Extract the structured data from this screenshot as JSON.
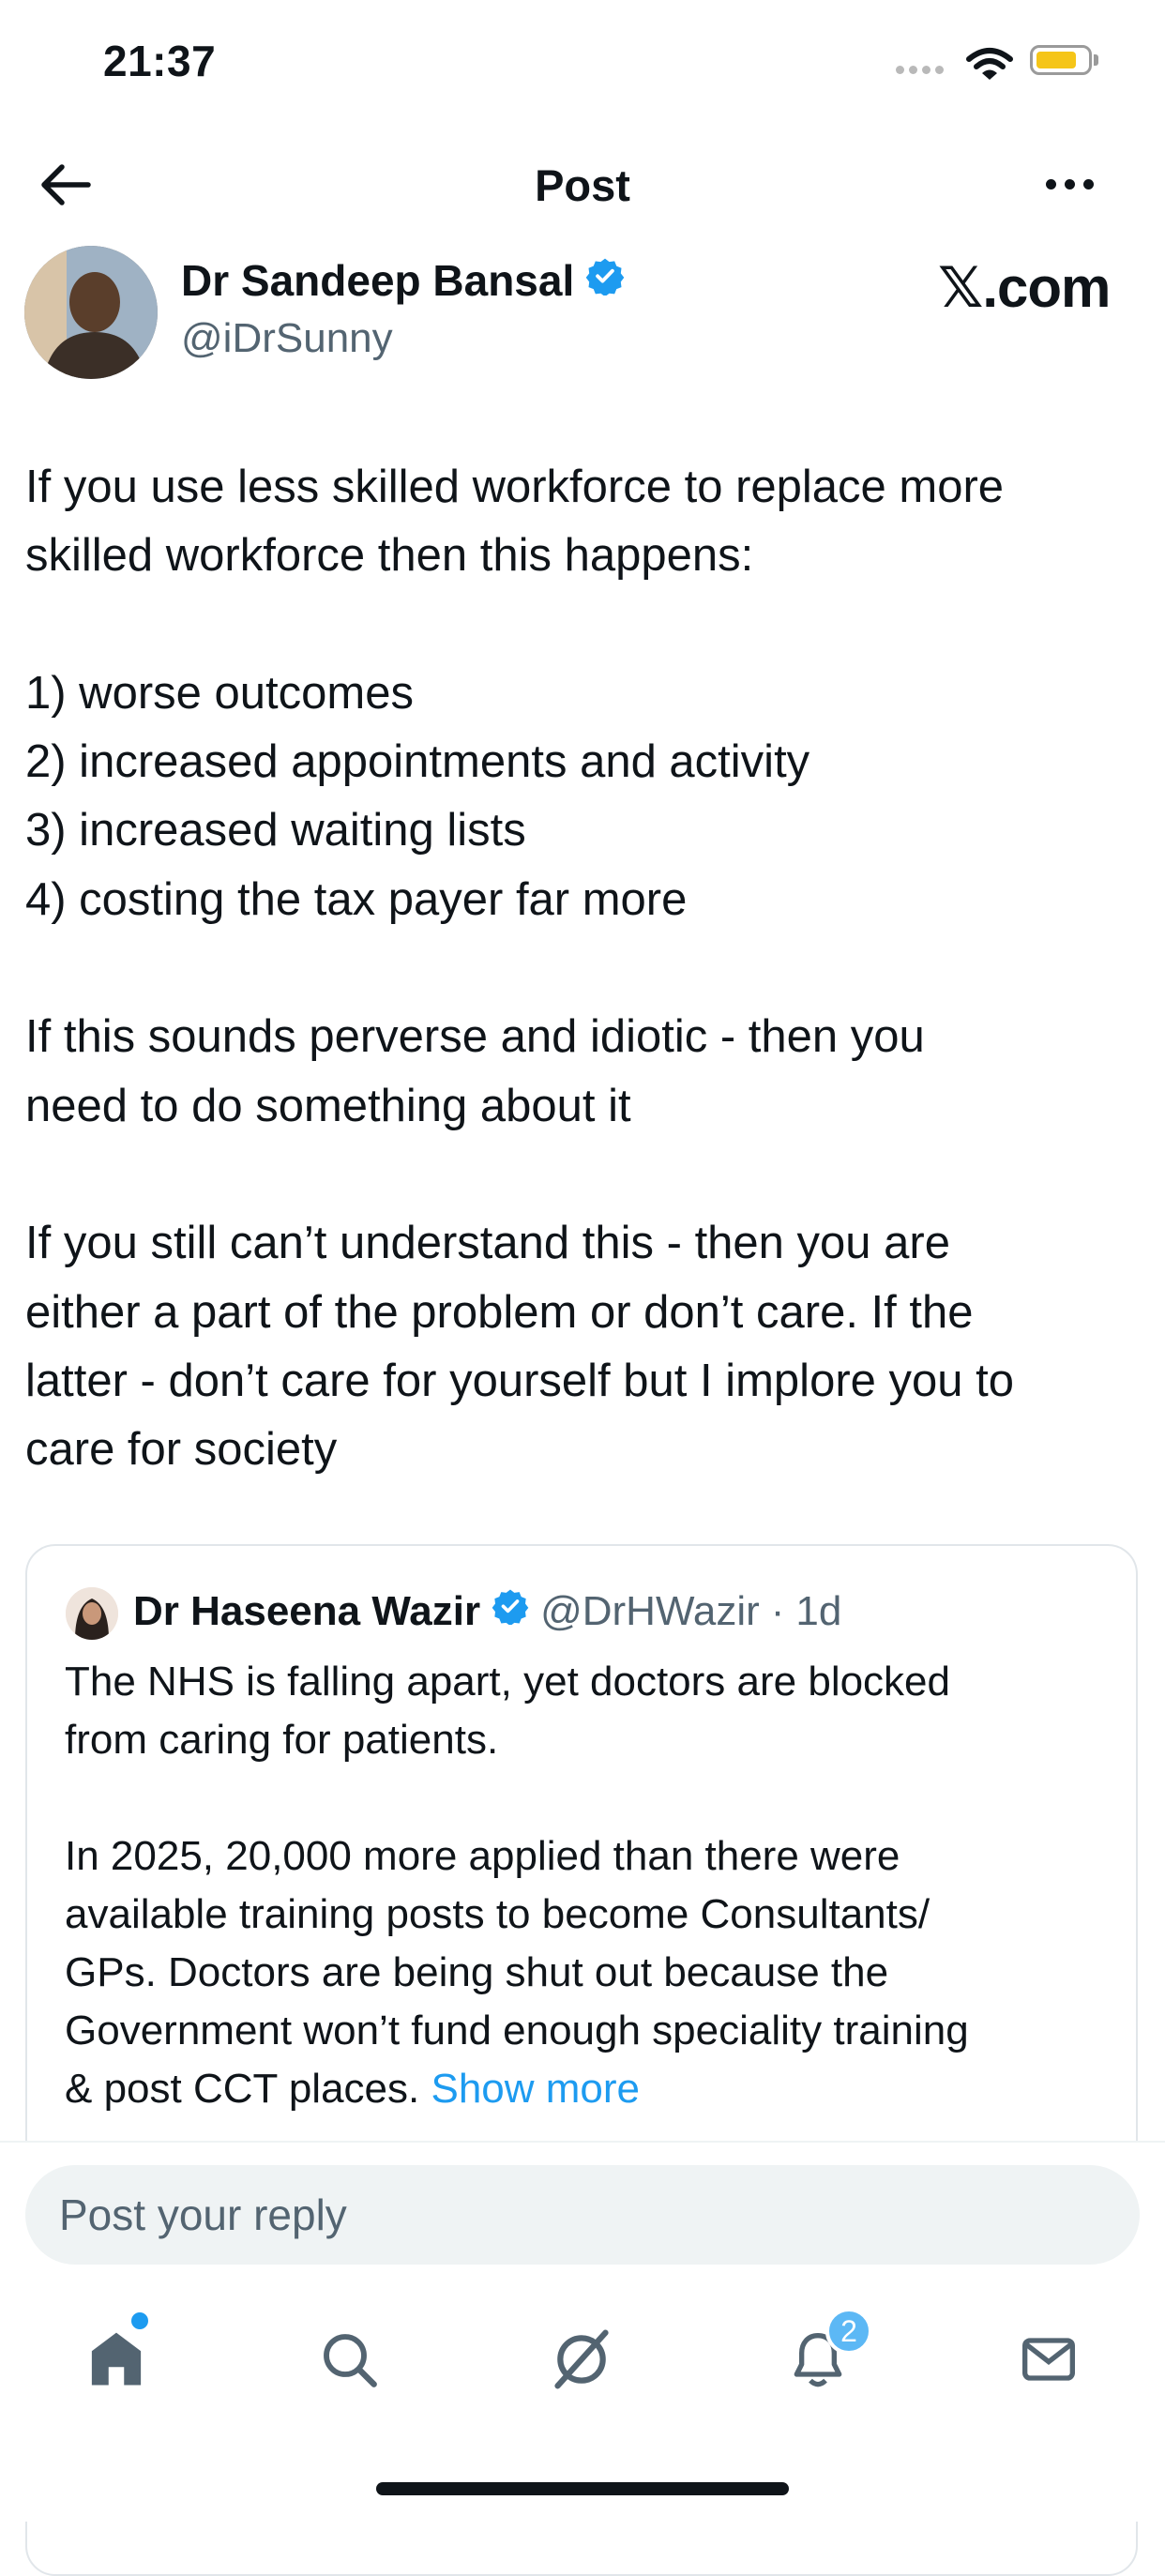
{
  "status_bar": {
    "time": "21:37"
  },
  "header": {
    "title": "Post"
  },
  "author": {
    "name": "Dr Sandeep Bansal",
    "handle": "@iDrSunny",
    "watermark": "𝕏.com"
  },
  "tweet": {
    "paragraphs": [
      [
        "If you use less skilled workforce to replace more",
        "skilled workforce then this happens:"
      ],
      [
        "1) worse outcomes",
        "2) increased appointments and activity",
        "3) increased waiting lists",
        "4) costing the tax payer far more"
      ],
      [
        "If this sounds perverse and idiotic - then you",
        "need to do something about it"
      ],
      [
        "If you still can’t understand this - then you are",
        "either a part of the problem or don’t care. If the",
        "latter - don’t care for yourself but I implore you to",
        "care for society"
      ]
    ]
  },
  "quote": {
    "name": "Dr Haseena Wazir",
    "handle": "@DrHWazir",
    "dot": "·",
    "time": "1d",
    "lines1": [
      "The NHS is falling apart, yet doctors are blocked",
      "from caring for patients."
    ],
    "lines2": [
      "In 2025, 20,000 more applied than there were",
      "available training posts to become Consultants/",
      "GPs. Doctors are being shut out because the",
      "Government won’t fund enough speciality training"
    ],
    "last_line": "& post CCT places. ",
    "show_more": "Show more"
  },
  "reply": {
    "placeholder": "Post your reply"
  },
  "tabbar": {
    "notifications_count": "2",
    "icons": [
      "home-icon",
      "search-icon",
      "grok-icon",
      "notifications-icon",
      "messages-icon"
    ]
  },
  "colors": {
    "accent": "#1d9bf0",
    "text": "#0f1419",
    "muted": "#536471"
  }
}
